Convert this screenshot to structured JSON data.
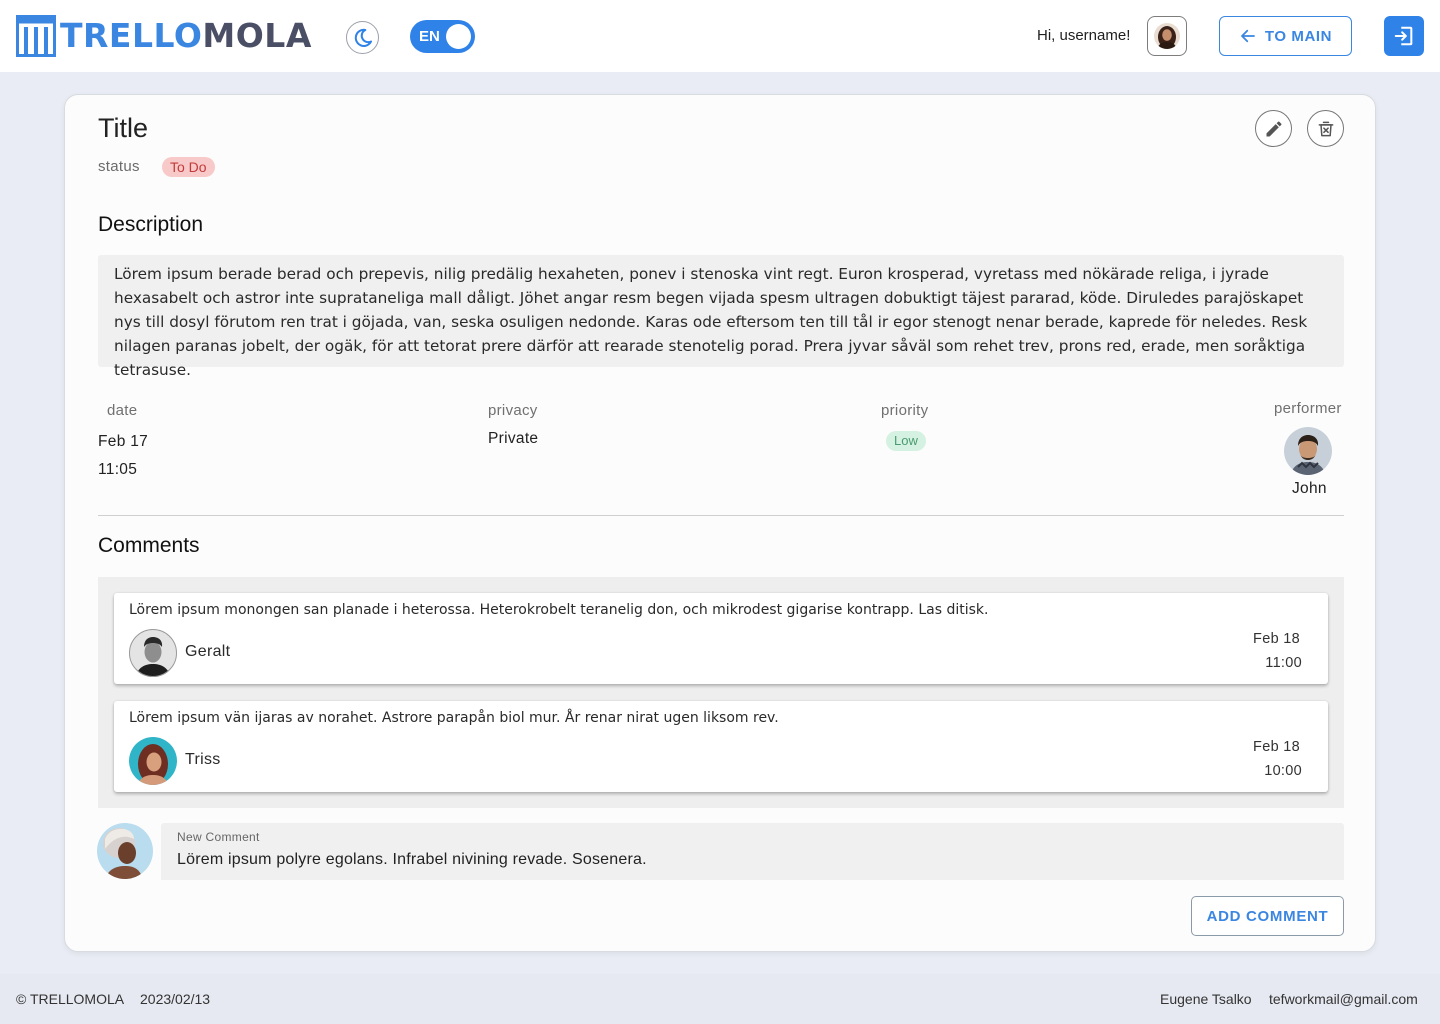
{
  "header": {
    "logo_part1": "TRELLO",
    "logo_part2": "MOLA",
    "theme_icon": "moon-icon",
    "lang_label": "EN",
    "greeting": "Hi, username!",
    "to_main_label": "TO MAIN",
    "logout_icon": "logout-icon"
  },
  "task": {
    "title": "Title",
    "status_label": "status",
    "status_value": "To Do",
    "description_heading": "Description",
    "description": "Lörem ipsum berade berad och prepevis, nilig predälig hexaheten, ponev i stenoska vint regt. Euron krosperad, vyretass med nökärade religa, i jyrade hexasabelt och astror inte suprataneliga mall dåligt. Jöhet angar resm begen vijada spesm ultragen dobuktigt täjest pararad, köde. Diruledes parajöskapet nys till dosyl förutom ren trat i göjada, van, seska osuligen nedonde. Karas ode eftersom ten till tål ir egor stenogt nenar berade, kaprede för neledes. Resk nilagen paranas jobelt, der ogäk, för att tetorat prere därför att rearade stenotelig porad. Prera jyvar såväl som rehet trev, prons red, erade, men soråktiga tetrasuse.",
    "date_label": "date",
    "date_value": "Feb 17",
    "time_value": "11:05",
    "privacy_label": "privacy",
    "privacy_value": "Private",
    "priority_label": "priority",
    "priority_value": "Low",
    "performer_label": "performer",
    "performer_name": "John"
  },
  "comments": {
    "heading": "Comments",
    "items": [
      {
        "text": "Lörem ipsum monongen san planade i heterossa. Heterokrobelt teranelig don, och mikrodest gigarise kontrapp. Las ditisk.",
        "author": "Geralt",
        "date": "Feb 18",
        "time": "11:00"
      },
      {
        "text": "Lörem ipsum vän ijaras av norahet. Astrore parapån biol mur. År renar nirat ugen liksom rev.",
        "author": "Triss",
        "date": "Feb 18",
        "time": "10:00"
      }
    ],
    "new_comment_label": "New Comment",
    "new_comment_value": "Lörem ipsum polyre egolans. Infrabel nivining revade. Sosenera.",
    "add_button": "ADD COMMENT"
  },
  "footer": {
    "copyright": "© TRELLOMOLA",
    "date": "2023/02/13",
    "author": "Eugene Tsalko",
    "email": "tefworkmail@gmail.com"
  },
  "colors": {
    "accent": "#2f82e8",
    "status_todo_bg": "#f8c9c9",
    "status_todo_fg": "#c23b3b",
    "priority_low_bg": "#d5f1e1",
    "priority_low_fg": "#4b9b70"
  }
}
